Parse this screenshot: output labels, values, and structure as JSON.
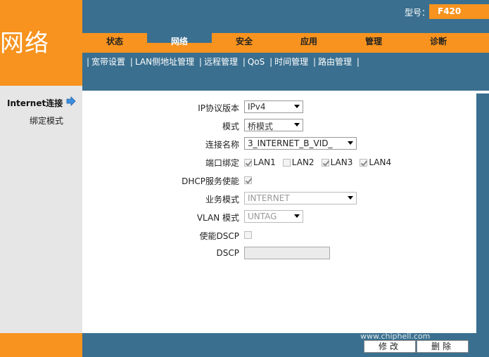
{
  "header": {
    "section_title": "网络",
    "model_label": "型号：",
    "model_value": "F420"
  },
  "tabs": [
    {
      "label": "状态",
      "active": false
    },
    {
      "label": "网络",
      "active": true
    },
    {
      "label": "安全",
      "active": false
    },
    {
      "label": "应用",
      "active": false
    },
    {
      "label": "管理",
      "active": false
    },
    {
      "label": "诊断",
      "active": false
    }
  ],
  "subnav": [
    {
      "label": "宽带设置"
    },
    {
      "label": "LAN侧地址管理"
    },
    {
      "label": "远程管理"
    },
    {
      "label": "QoS"
    },
    {
      "label": "时间管理"
    },
    {
      "label": "路由管理"
    }
  ],
  "subnav_separator": "|",
  "sidebar": {
    "main_item": "Internet连接",
    "sub_item": "绑定模式"
  },
  "form": {
    "ip_version_label": "IP协议版本",
    "ip_version_value": "IPv4",
    "mode_label": "模式",
    "mode_value": "桥模式",
    "conn_name_label": "连接名称",
    "conn_name_value": "3_INTERNET_B_VID_",
    "port_binding_label": "端口绑定",
    "ports": [
      {
        "name": "LAN1",
        "checked": true
      },
      {
        "name": "LAN2",
        "checked": false
      },
      {
        "name": "LAN3",
        "checked": true
      },
      {
        "name": "LAN4",
        "checked": true
      }
    ],
    "dhcp_label": "DHCP服务使能",
    "dhcp_checked": true,
    "service_mode_label": "业务模式",
    "service_mode_value": "INTERNET",
    "vlan_mode_label": "VLAN 模式",
    "vlan_mode_value": "UNTAG",
    "dscp_enable_label": "使能DSCP",
    "dscp_enable_checked": false,
    "dscp_label": "DSCP",
    "dscp_value": ""
  },
  "buttons": {
    "modify": "修改",
    "delete": "删除"
  },
  "watermark": "www.chiphell.com",
  "colors": {
    "orange": "#f7931e",
    "blue": "#3a6f8f",
    "side_gray": "#e6e6e6"
  }
}
